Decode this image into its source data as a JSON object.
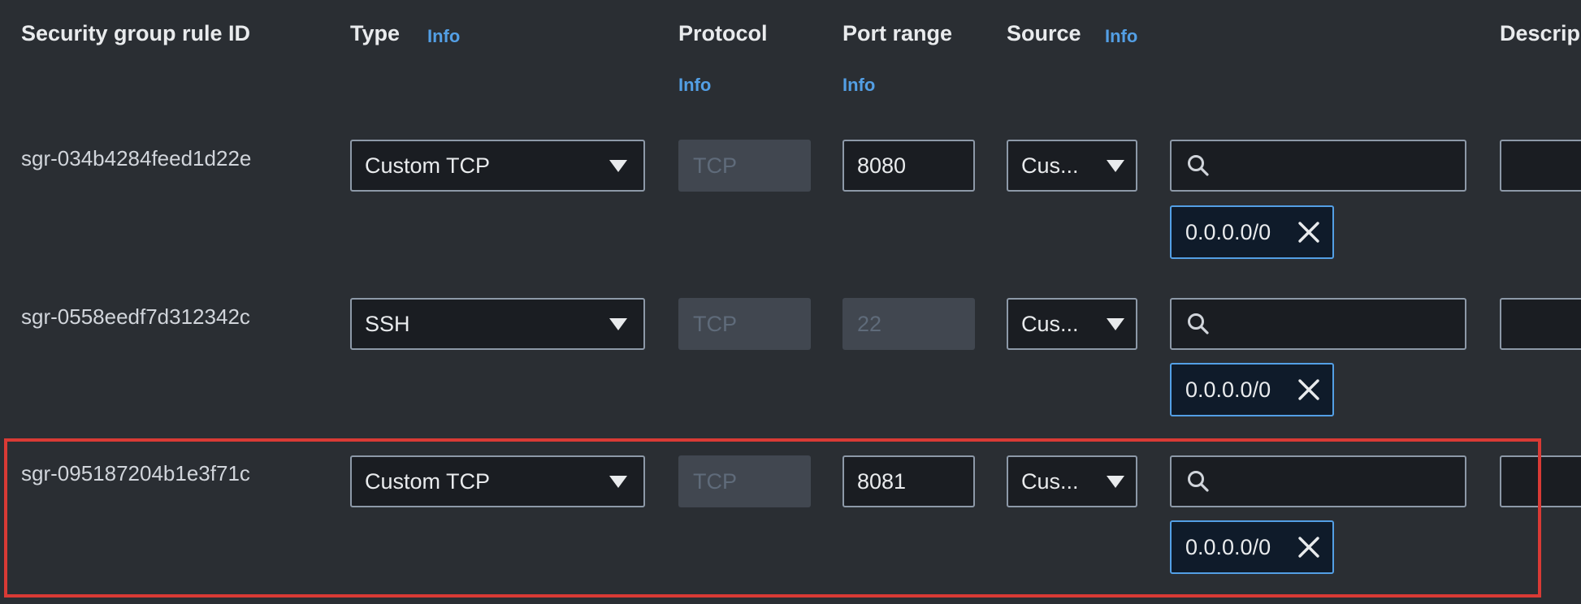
{
  "headers": {
    "rule_id": "Security group rule ID",
    "type": "Type",
    "type_info": "Info",
    "protocol": "Protocol",
    "protocol_info": "Info",
    "port_range": "Port range",
    "port_range_info": "Info",
    "source": "Source",
    "source_info": "Info",
    "description": "Descrip"
  },
  "rules": [
    {
      "id": "sgr-034b4284feed1d22e",
      "type": "Custom TCP",
      "protocol": "TCP",
      "port_range": "8080",
      "port_editable": true,
      "source": "Cus...",
      "cidr": "0.0.0.0/0",
      "highlighted": false
    },
    {
      "id": "sgr-0558eedf7d312342c",
      "type": "SSH",
      "protocol": "TCP",
      "port_range": "22",
      "port_editable": false,
      "source": "Cus...",
      "cidr": "0.0.0.0/0",
      "highlighted": false
    },
    {
      "id": "sgr-095187204b1e3f71c",
      "type": "Custom TCP",
      "protocol": "TCP",
      "port_range": "8081",
      "port_editable": true,
      "source": "Cus...",
      "cidr": "0.0.0.0/0",
      "highlighted": true
    }
  ],
  "colors": {
    "background": "#2a2e33",
    "input_bg": "#1a1d22",
    "info_link": "#539fe5",
    "highlight_border": "#d93a35",
    "disabled_bg": "#414750"
  },
  "icons": {
    "type_dropdown": "caret-down-icon",
    "source_dropdown": "caret-down-icon",
    "search": "search-icon",
    "remove_token": "close-icon"
  }
}
